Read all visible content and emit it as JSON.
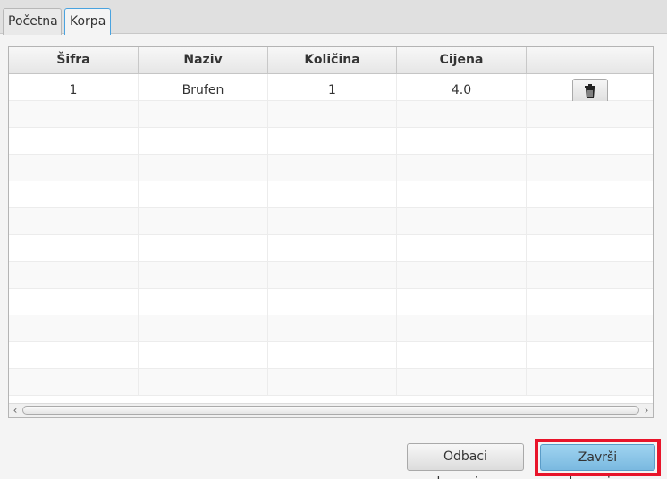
{
  "tabs": [
    {
      "label": "Početna",
      "active": false
    },
    {
      "label": "Korpa",
      "active": true
    }
  ],
  "table": {
    "columns": [
      "Šifra",
      "Naziv",
      "Količina",
      "Cijena",
      ""
    ],
    "rows": [
      {
        "sifra": "1",
        "naziv": "Brufen",
        "kolicina": "1",
        "cijena": "4.0",
        "action_icon": "trash-icon"
      }
    ],
    "empty_row_count": 11
  },
  "buttons": {
    "cancel": "Odbaci kupovinu",
    "finish": "Završi kupovinu"
  },
  "colors": {
    "highlight_border": "#e8142a",
    "finish_button": "#8cc6e8",
    "active_tab_border": "#4aa3df"
  }
}
